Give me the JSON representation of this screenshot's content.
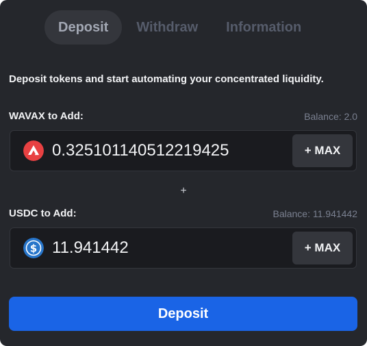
{
  "tabs": [
    {
      "label": "Deposit",
      "active": true
    },
    {
      "label": "Withdraw",
      "active": false
    },
    {
      "label": "Information",
      "active": false
    }
  ],
  "description": "Deposit tokens and start automating your concentrated liquidity.",
  "token_a": {
    "label": "WAVAX to Add:",
    "balance": "Balance: 2.0",
    "value": "0.325101140512219425",
    "icon": "avalanche-icon",
    "icon_color": "#e84142",
    "max_label": "+ MAX"
  },
  "separator": "+",
  "token_b": {
    "label": "USDC to Add:",
    "balance": "Balance: 11.941442",
    "value": "11.941442",
    "icon": "usdc-icon",
    "icon_color": "#2775ca",
    "max_label": "+ MAX"
  },
  "deposit_button": "Deposit",
  "colors": {
    "panel_bg": "#25272c",
    "accent": "#1a64e6"
  }
}
